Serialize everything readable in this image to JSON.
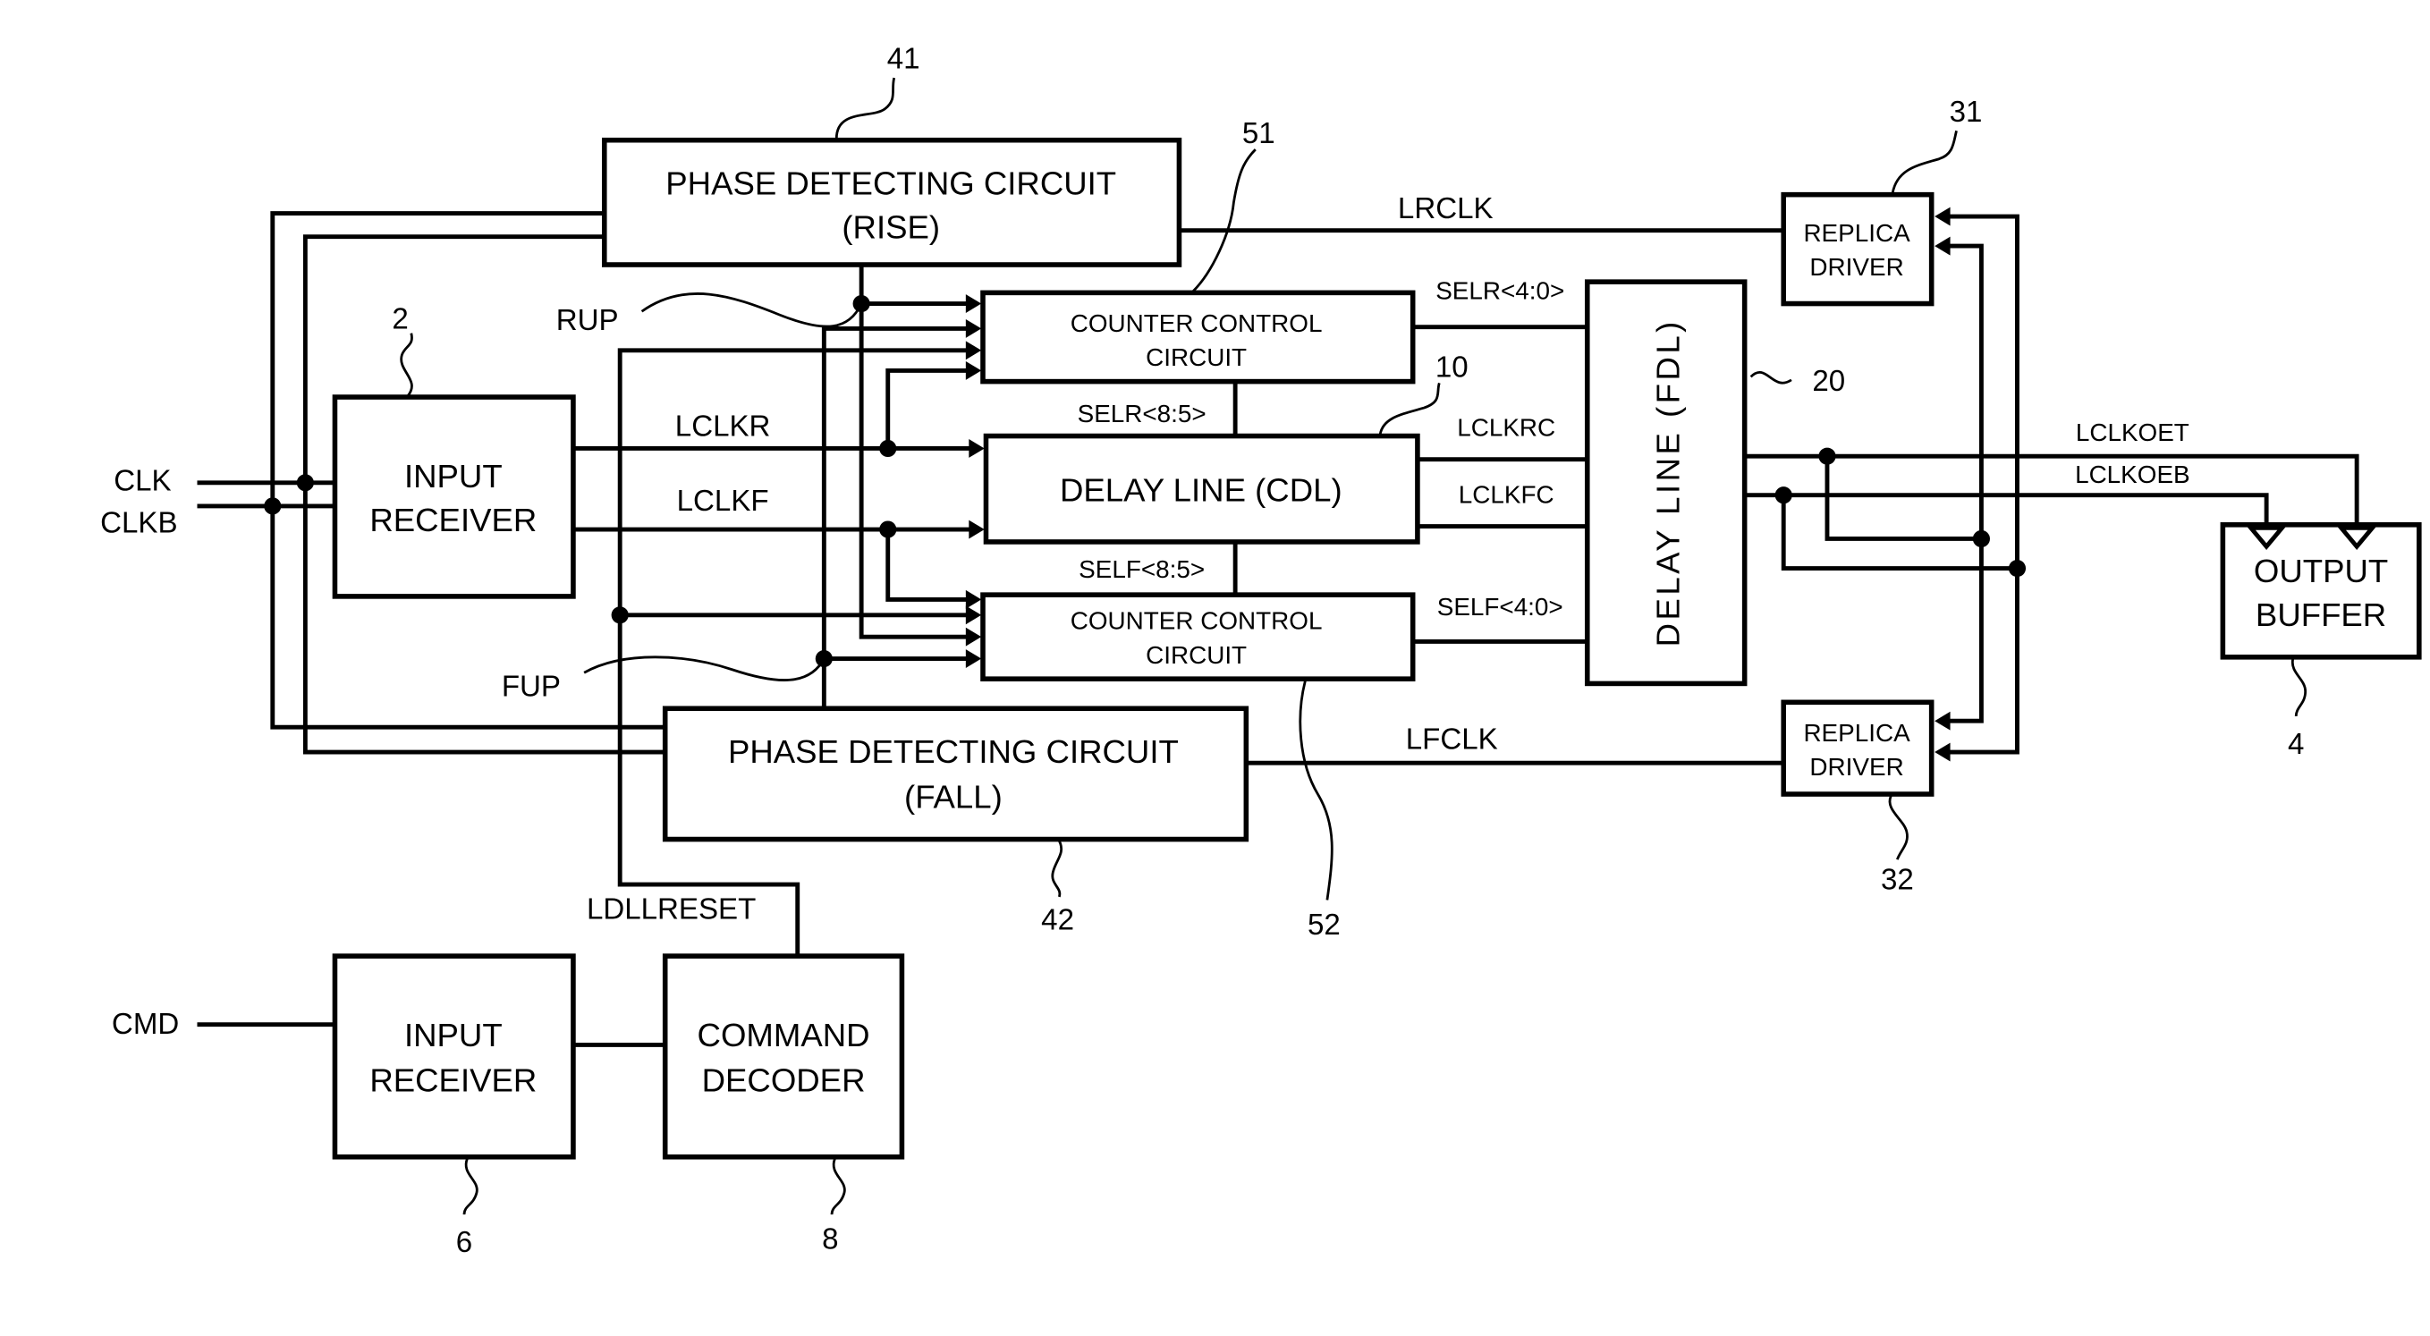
{
  "figure": {
    "blocks": {
      "input_receiver_clk": {
        "line1": "INPUT",
        "line2": "RECEIVER",
        "ref": "2"
      },
      "phase_detect_rise": {
        "line1": "PHASE DETECTING CIRCUIT",
        "line2": "(RISE)",
        "ref": "41"
      },
      "phase_detect_fall": {
        "line1": "PHASE DETECTING CIRCUIT",
        "line2": "(FALL)",
        "ref": "42"
      },
      "counter_control_rise": {
        "line1": "COUNTER CONTROL",
        "line2": "CIRCUIT",
        "ref": "51"
      },
      "counter_control_fall": {
        "line1": "COUNTER CONTROL",
        "line2": "CIRCUIT",
        "ref": "52"
      },
      "delay_line_cdl": {
        "line1": "DELAY LINE (CDL)",
        "ref": "10"
      },
      "delay_line_fdl": {
        "line1": "DELAY LINE (FDL)",
        "ref": "20"
      },
      "replica_driver_rise": {
        "line1": "REPLICA",
        "line2": "DRIVER",
        "ref": "31"
      },
      "replica_driver_fall": {
        "line1": "REPLICA",
        "line2": "DRIVER",
        "ref": "32"
      },
      "output_buffer": {
        "line1": "OUTPUT",
        "line2": "BUFFER",
        "ref": "4"
      },
      "input_receiver_cmd": {
        "line1": "INPUT",
        "line2": "RECEIVER",
        "ref": "6"
      },
      "command_decoder": {
        "line1": "COMMAND",
        "line2": "DECODER",
        "ref": "8"
      }
    },
    "signals": {
      "clk": "CLK",
      "clkb": "CLKB",
      "cmd": "CMD",
      "lclkr": "LCLKR",
      "lclkf": "LCLKF",
      "rup": "RUP",
      "fup": "FUP",
      "selr_hi": "SELR<8:5>",
      "self_hi": "SELF<8:5>",
      "selr_lo": "SELR<4:0>",
      "self_lo": "SELF<4:0>",
      "lclkrc": "LCLKRC",
      "lclkfc": "LCLKFC",
      "lrclk": "LRCLK",
      "lfclk": "LFCLK",
      "lclkoet": "LCLKOET",
      "lclkoeb": "LCLKOEB",
      "ldllreset": "LDLLRESET"
    }
  }
}
